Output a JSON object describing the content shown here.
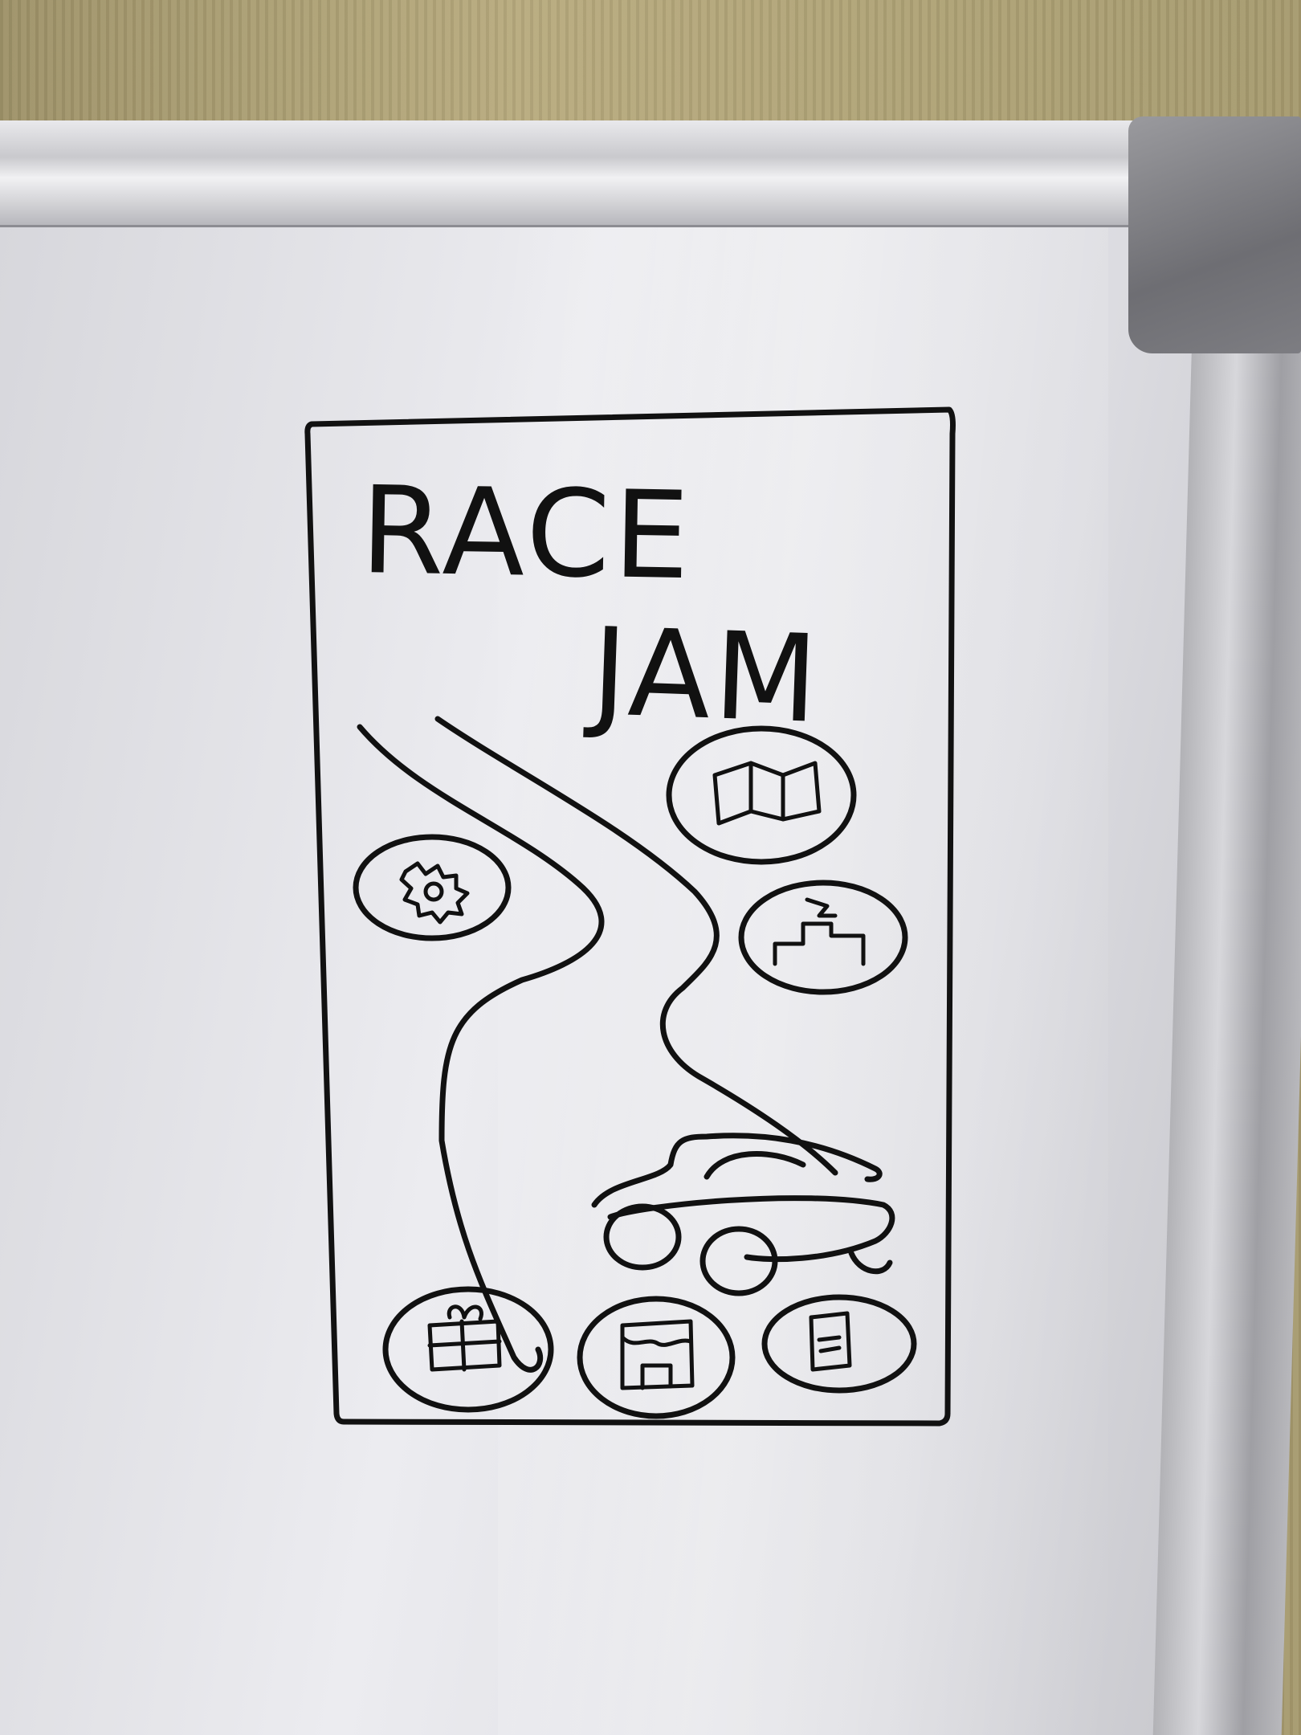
{
  "sketch": {
    "title_line1": "RACE",
    "title_line2": "JAM"
  },
  "icons": {
    "map": "map-icon",
    "gear": "gear-icon",
    "podium": "podium-icon",
    "car": "car-icon",
    "gift": "gift-icon",
    "shop": "shop-icon",
    "notes": "notes-icon"
  },
  "colors": {
    "ink": "#111111",
    "board": "#e6e6ea",
    "wall": "#b0a476"
  }
}
